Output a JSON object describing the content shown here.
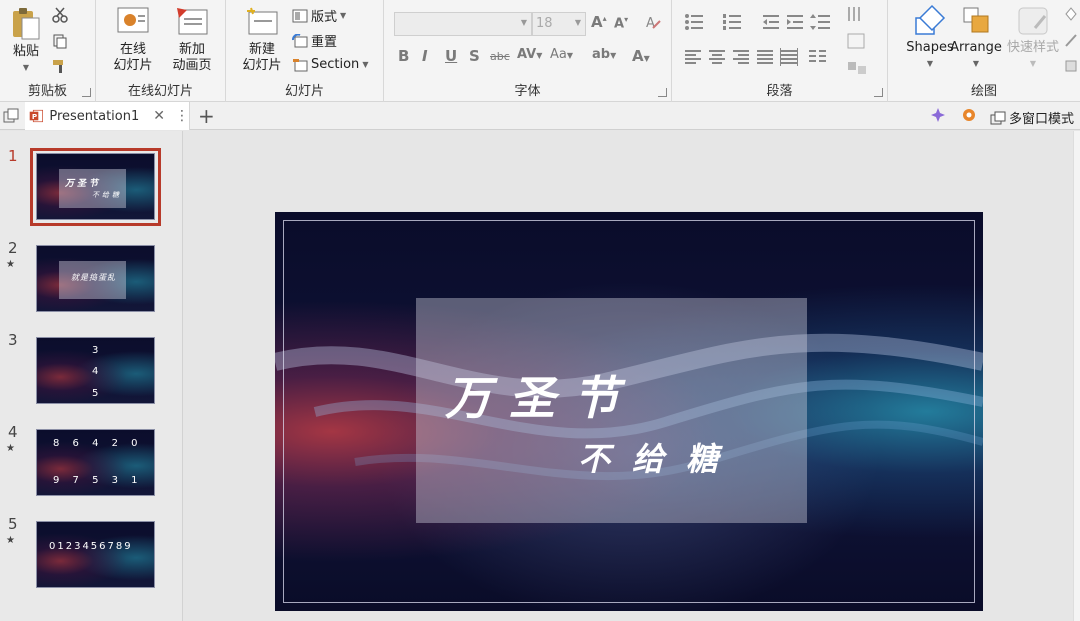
{
  "ribbon": {
    "clipboard": {
      "label": "剪贴板",
      "paste": "粘贴"
    },
    "online_slides": {
      "label": "在线幻灯片",
      "online_slide_1": "在线",
      "online_slide_2": "幻灯片",
      "new_anim_1": "新加",
      "new_anim_2": "动画页"
    },
    "slides": {
      "label": "幻灯片",
      "new_slide_1": "新建",
      "new_slide_2": "幻灯片",
      "layout": "版式",
      "reset": "重置",
      "section": "Section"
    },
    "font": {
      "label": "字体",
      "font_name": "",
      "font_size": "18"
    },
    "paragraph": {
      "label": "段落"
    },
    "drawing": {
      "label": "绘图",
      "shapes": "Shapes",
      "arrange": "Arrange",
      "quick_styles": "快速样式"
    }
  },
  "tabbar": {
    "doc_title": "Presentation1",
    "multi_window": "多窗口模式"
  },
  "thumbnails": [
    {
      "num": "1",
      "star": "",
      "line1": "万圣节",
      "line2": "不给糖"
    },
    {
      "num": "2",
      "star": "★",
      "line1": "就是捣蛋乱",
      "line2": ""
    },
    {
      "num": "3",
      "star": "",
      "line1": "3",
      "line2": "4",
      "line3": "5"
    },
    {
      "num": "4",
      "star": "★",
      "line1": "8 6 4 2 0",
      "line2": "9 7 5 3 1"
    },
    {
      "num": "5",
      "star": "★",
      "line1": "0123456789",
      "line2": ""
    }
  ],
  "slide": {
    "title": "万圣节",
    "subtitle": "不给糖"
  },
  "colors": {
    "accent": "#b73a2a",
    "ribbon_bg": "#f4f4f4"
  }
}
